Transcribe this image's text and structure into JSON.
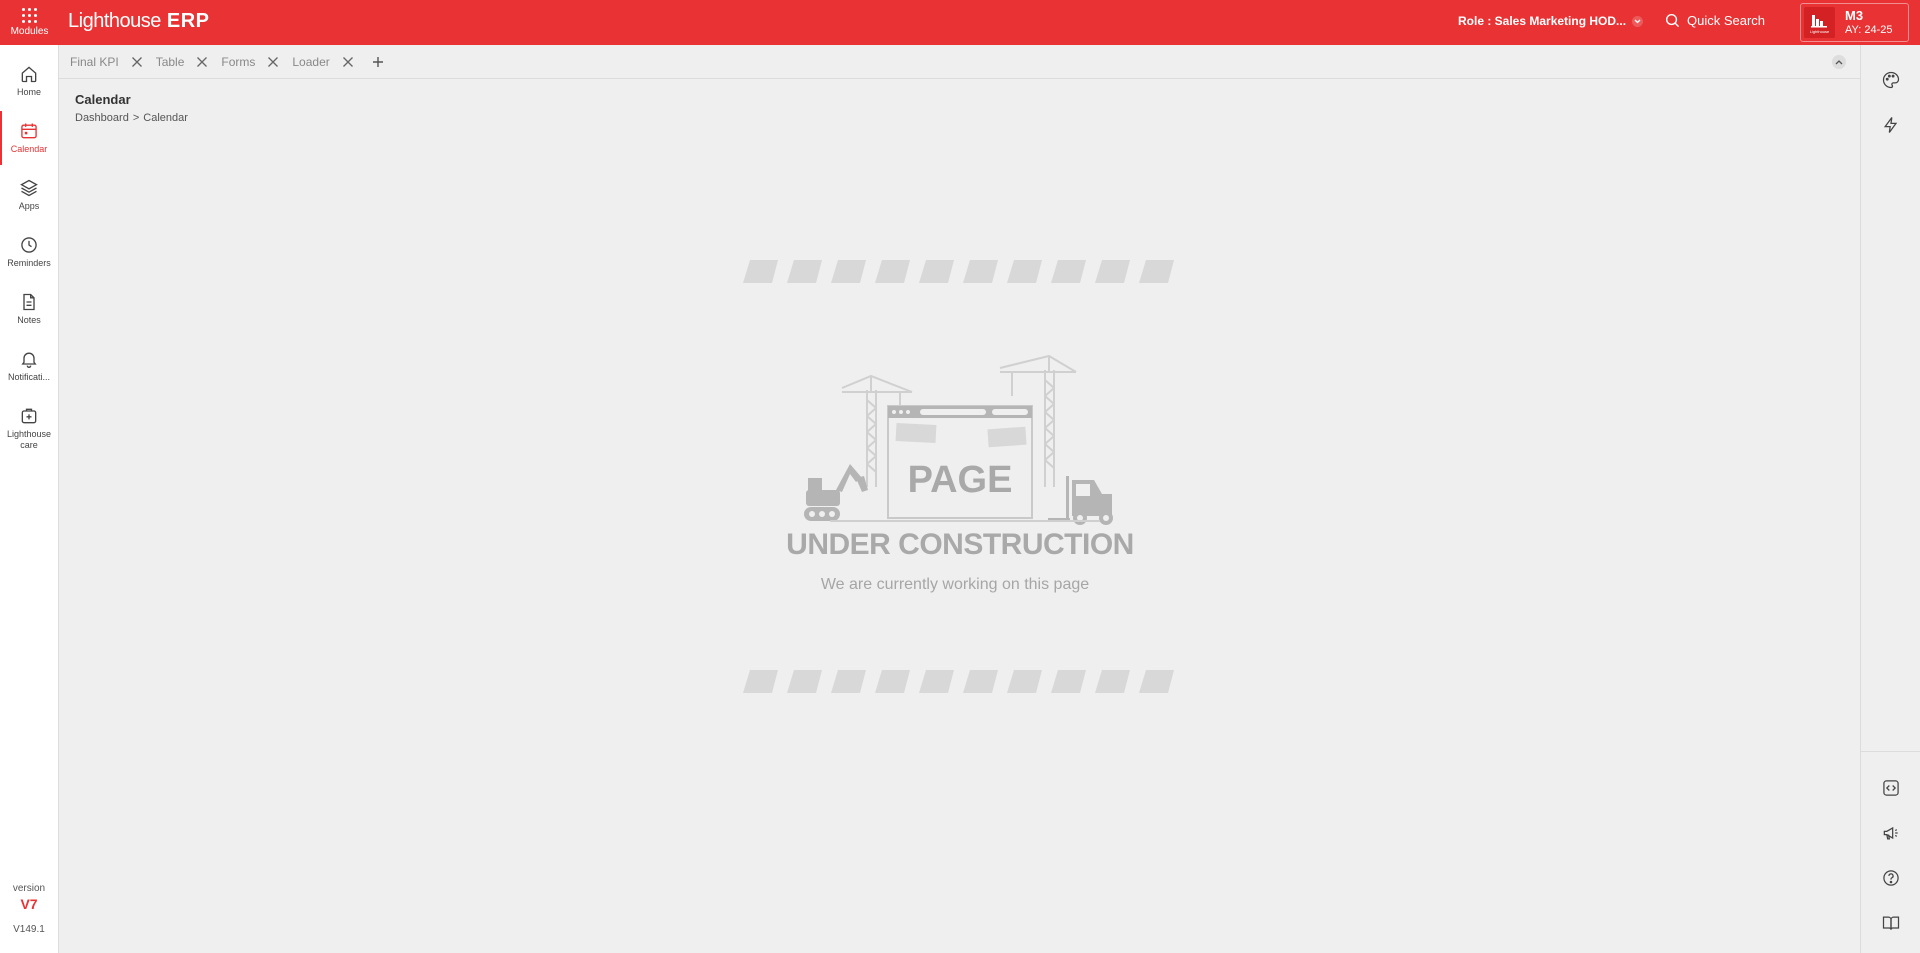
{
  "topbar": {
    "modules_label": "Modules",
    "logo_main": "Lighthouse",
    "logo_erp": "ERP",
    "role_label": "Role : Sales Marketing HOD...",
    "quick_search": "Quick Search",
    "org_code": "M3",
    "org_year": "AY: 24-25",
    "org_logo_text": "Lighthouse"
  },
  "sidebar": {
    "items": [
      {
        "label": "Home",
        "icon": "home-icon"
      },
      {
        "label": "Calendar",
        "icon": "calendar-icon",
        "active": true
      },
      {
        "label": "Apps",
        "icon": "layers-icon"
      },
      {
        "label": "Reminders",
        "icon": "clock-icon"
      },
      {
        "label": "Notes",
        "icon": "note-icon"
      },
      {
        "label": "Notificati...",
        "icon": "bell-icon"
      },
      {
        "label": "Lighthouse care",
        "icon": "medical-bag-icon"
      }
    ],
    "version_label": "version",
    "version_number": "V7",
    "build": "V149.1"
  },
  "tabs": [
    {
      "label": "Final KPI"
    },
    {
      "label": "Table"
    },
    {
      "label": "Forms"
    },
    {
      "label": "Loader"
    }
  ],
  "page": {
    "title": "Calendar",
    "breadcrumb": [
      "Dashboard",
      ">",
      "Calendar"
    ]
  },
  "construction": {
    "sign_text": "PAGE",
    "title": "UNDER CONSTRUCTION",
    "subtitle": "We are currently working on this page"
  },
  "right_sidebar": {
    "icons": [
      "palette-icon",
      "lightning-icon",
      "code-icon",
      "megaphone-icon",
      "help-icon",
      "book-icon"
    ]
  },
  "colors": {
    "brand": "#e83234",
    "background": "#efefef",
    "illustration": "#b5b5b5"
  }
}
